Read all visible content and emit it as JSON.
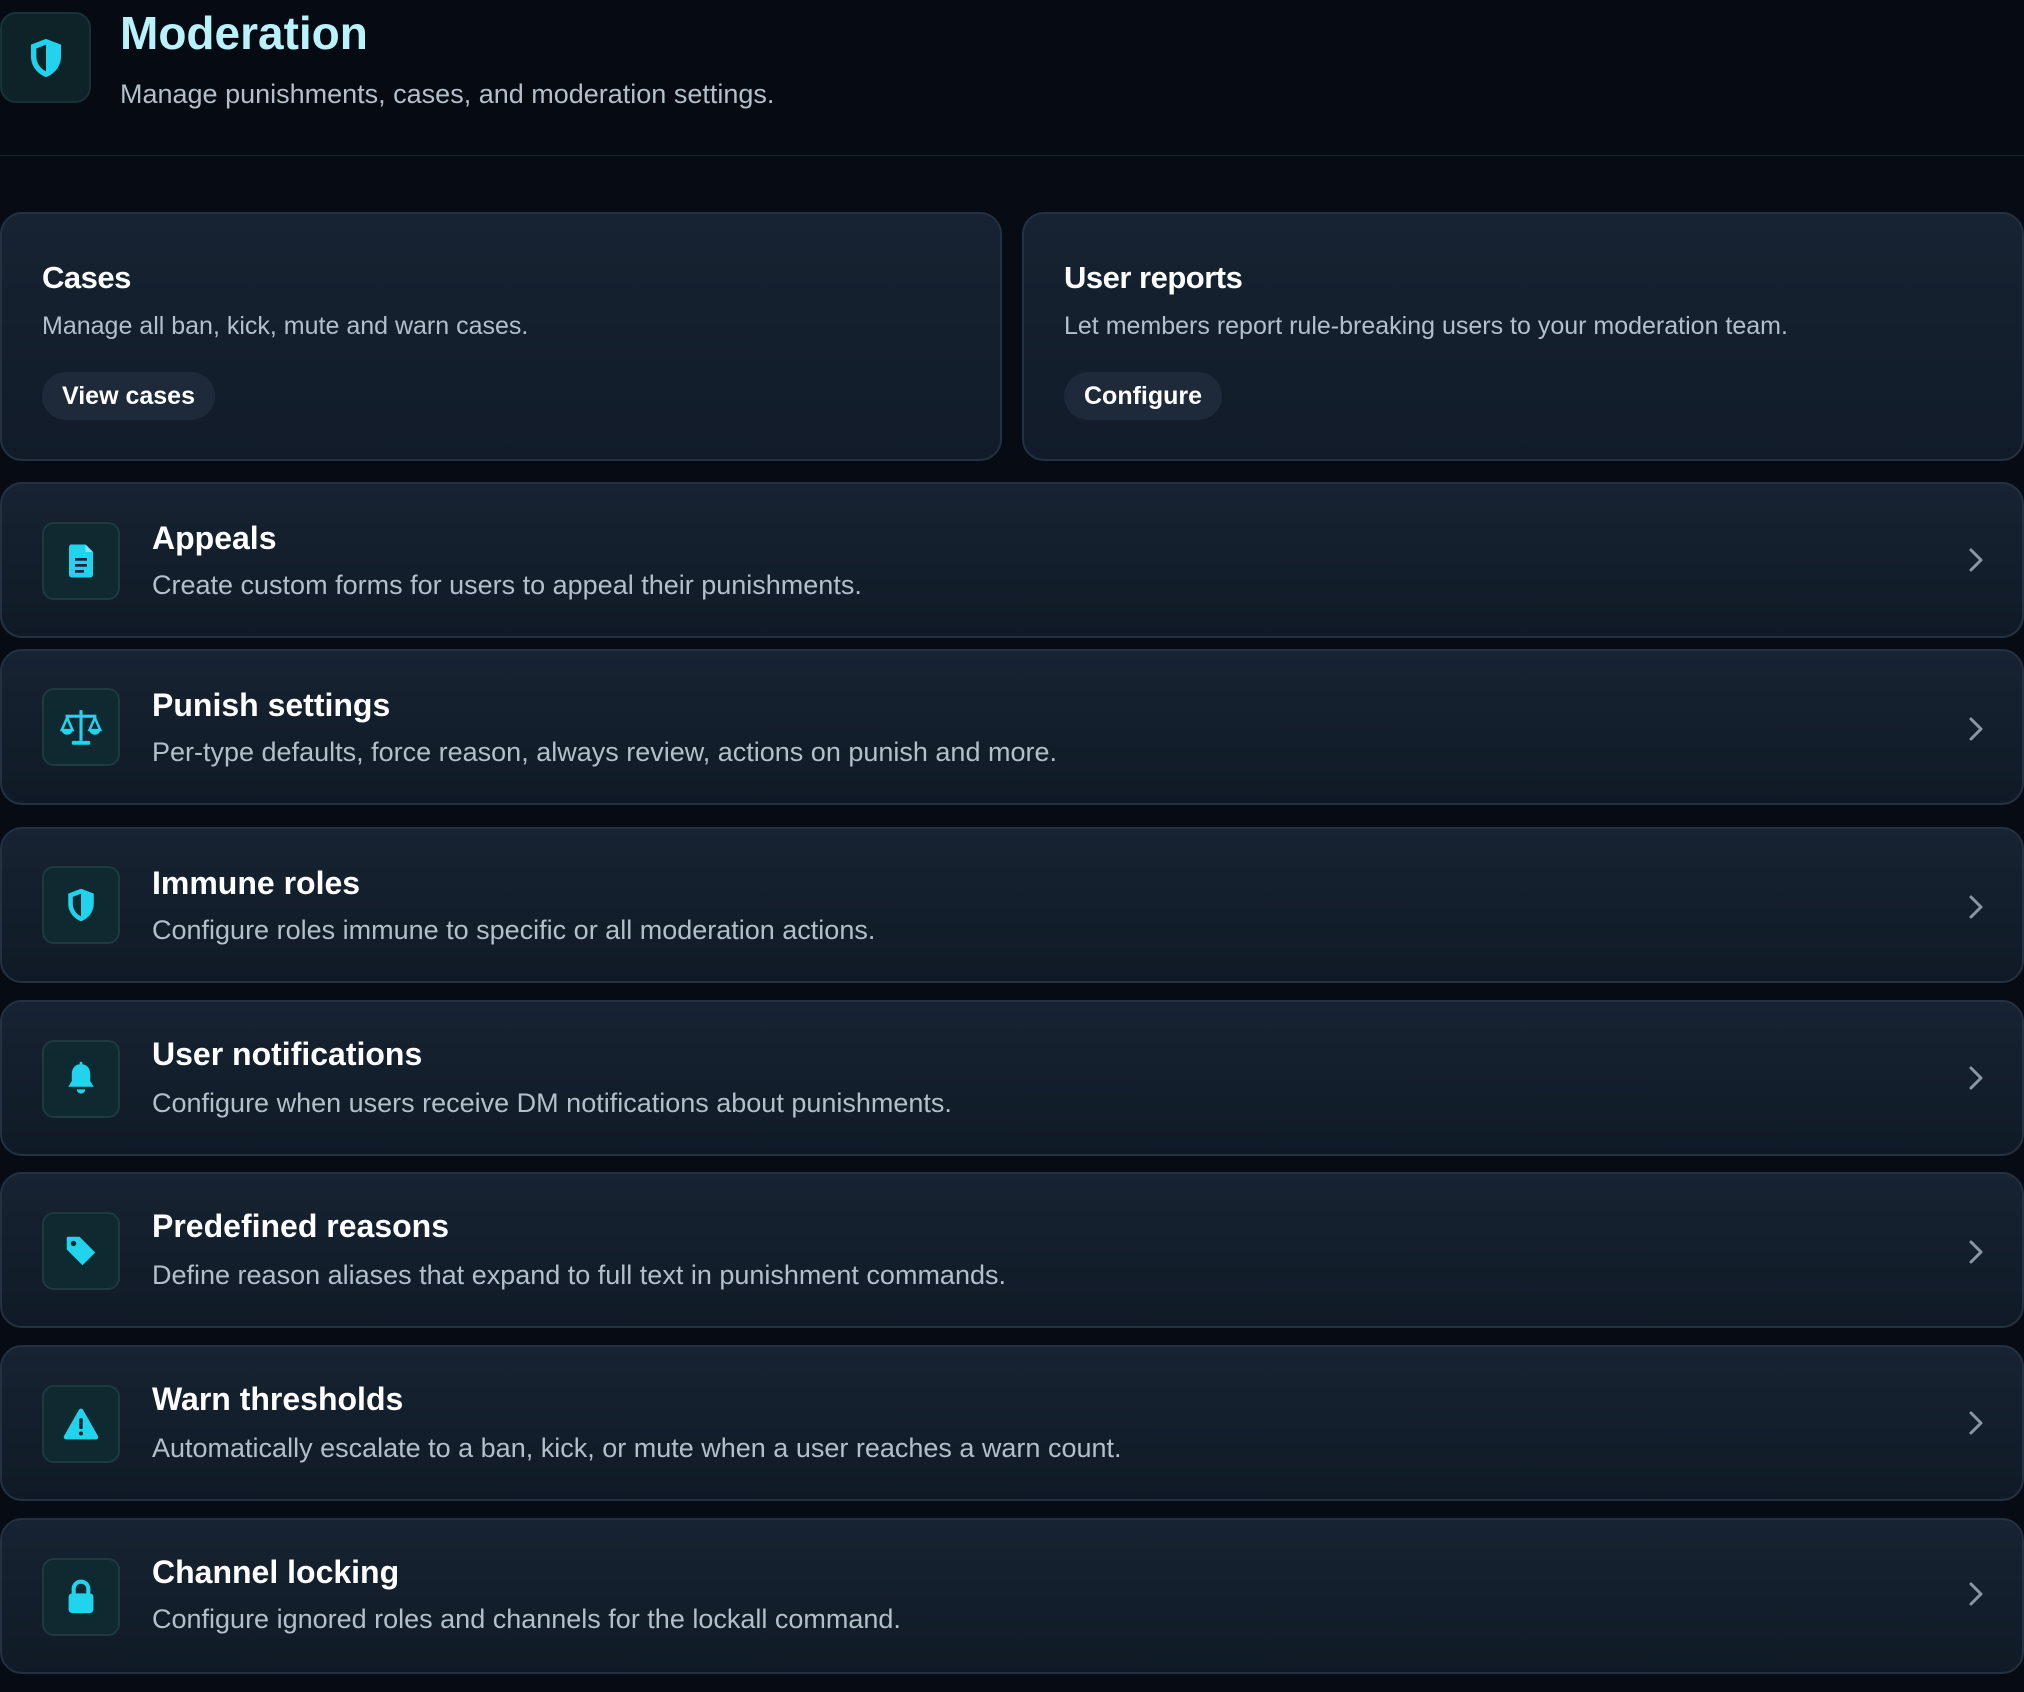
{
  "header": {
    "title": "Moderation",
    "subtitle": "Manage punishments, cases, and moderation settings.",
    "icon": "shield-icon"
  },
  "cards": [
    {
      "title": "Cases",
      "description": "Manage all ban, kick, mute and warn cases.",
      "button_label": "View cases"
    },
    {
      "title": "User reports",
      "description": "Let members report rule-breaking users to your moderation team.",
      "button_label": "Configure"
    }
  ],
  "settings": [
    {
      "title": "Appeals",
      "description": "Create custom forms for users to appeal their punishments.",
      "icon": "document-icon"
    },
    {
      "title": "Punish settings",
      "description": "Per-type defaults, force reason, always review, actions on punish and more.",
      "icon": "scale-icon"
    },
    {
      "title": "Immune roles",
      "description": "Configure roles immune to specific or all moderation actions.",
      "icon": "shield-icon"
    },
    {
      "title": "User notifications",
      "description": "Configure when users receive DM notifications about punishments.",
      "icon": "bell-icon"
    },
    {
      "title": "Predefined reasons",
      "description": "Define reason aliases that expand to full text in punishment commands.",
      "icon": "tag-icon"
    },
    {
      "title": "Warn thresholds",
      "description": "Automatically escalate to a ban, kick, or mute when a user reaches a warn count.",
      "icon": "warning-icon"
    },
    {
      "title": "Channel locking",
      "description": "Configure ignored roles and channels for the lockall command.",
      "icon": "lock-icon"
    }
  ],
  "colors": {
    "accent": "#22d3ee",
    "background": "#070b13",
    "card": "#131e2c",
    "title": "#b9f2fb",
    "muted": "#b4bfcc"
  }
}
